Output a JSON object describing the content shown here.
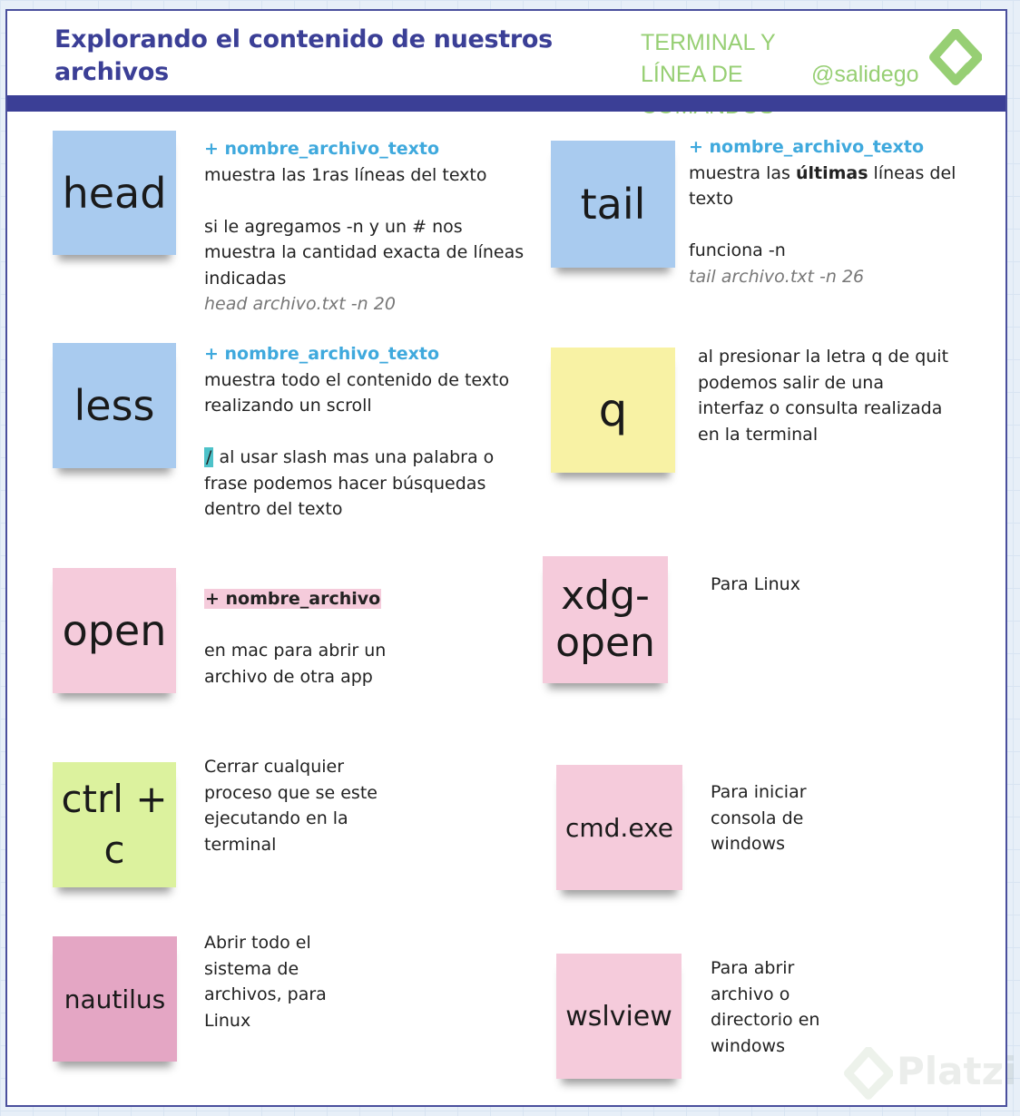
{
  "header": {
    "title": "Explorando el contenido de nuestros archivos",
    "category": "TERMINAL Y LÍNEA DE COMANDOS",
    "handle": "@salidego",
    "logo_icon": "platzi-logo-icon",
    "accent_color": "#3b3f96",
    "category_color": "#97cf74"
  },
  "notes": {
    "head": {
      "label": "head",
      "color": "#a9cbef",
      "arg": "+ nombre_archivo_texto",
      "line1": "muestra las 1ras líneas del texto",
      "line2": "si le agregamos -n y un # nos muestra la cantidad exacta de líneas indicadas",
      "example": "head archivo.txt -n 20"
    },
    "tail": {
      "label": "tail",
      "color": "#a9cbef",
      "arg": "+ nombre_archivo_texto",
      "line1_pre": "muestra las ",
      "line1_bold": "últimas",
      "line1_post": " líneas del texto",
      "line2": "funciona  -n",
      "example": "tail archivo.txt -n 26"
    },
    "less": {
      "label": "less",
      "color": "#a9cbef",
      "arg": "+ nombre_archivo_texto",
      "line1": "muestra todo el contenido de texto realizando un scroll",
      "slash": "/",
      "line2": " al usar slash mas una palabra o frase podemos hacer búsquedas dentro del texto"
    },
    "q": {
      "label": "q",
      "color": "#f8f2a4",
      "desc": "al presionar la letra  q de quit podemos salir de una interfaz o consulta realizada en la terminal"
    },
    "open": {
      "label": "open",
      "color": "#f5cbdb",
      "arg": "+ nombre_archivo",
      "desc": "en mac para abrir un archivo de otra app"
    },
    "xdg": {
      "label_line1": "xdg-",
      "label_line2": "open",
      "color": "#f5cbdb",
      "desc": "Para Linux"
    },
    "ctrl": {
      "label_line1": "ctrl +",
      "label_line2": "c",
      "color": "#dcf29e",
      "desc": "Cerrar cualquier proceso que se este ejecutando en la terminal"
    },
    "cmd": {
      "label": "cmd.exe",
      "color": "#f5cbdb",
      "desc": "Para iniciar consola de windows"
    },
    "nautilus": {
      "label": "nautilus",
      "color": "#e4a6c4",
      "desc": "Abrir todo el sistema de archivos, para Linux"
    },
    "wslview": {
      "label": "wslview",
      "color": "#f5cbdb",
      "desc": "Para abrir archivo o directorio en windows"
    }
  },
  "watermark": {
    "text": "Platzi",
    "icon": "platzi-watermark-icon"
  }
}
